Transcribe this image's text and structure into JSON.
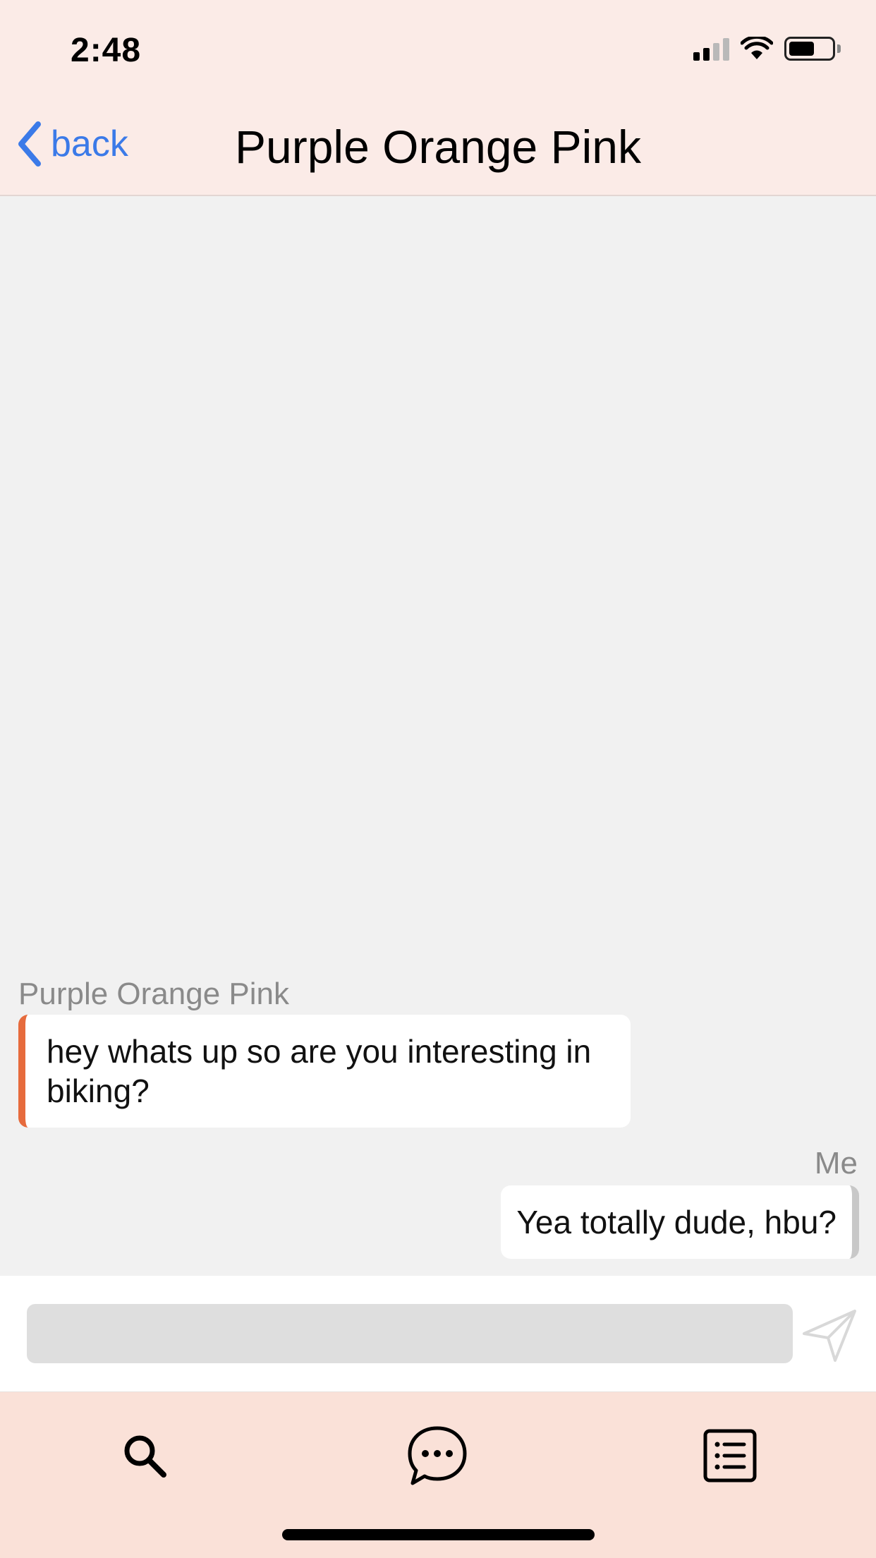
{
  "status_bar": {
    "time": "2:48",
    "icons": [
      "cellular-signal-icon",
      "wifi-icon",
      "battery-icon"
    ]
  },
  "nav": {
    "back_label": "back",
    "title": "Purple Orange Pink",
    "accent_color": "#3b7ae8"
  },
  "messages": [
    {
      "sender": "Purple Orange Pink",
      "text": "hey whats up so are you interesting in biking?",
      "direction": "incoming",
      "accent_color": "#e66b3d"
    },
    {
      "sender": "Me",
      "text": "Yea totally dude, hbu?",
      "direction": "outgoing",
      "accent_color": "#c8c8c8"
    }
  ],
  "composer": {
    "value": "",
    "placeholder": "",
    "send_icon": "send-icon"
  },
  "tabbar": {
    "tabs": [
      {
        "icon": "search-icon"
      },
      {
        "icon": "chat-bubble-icon"
      },
      {
        "icon": "list-icon"
      }
    ],
    "background": "#fae1d8"
  }
}
